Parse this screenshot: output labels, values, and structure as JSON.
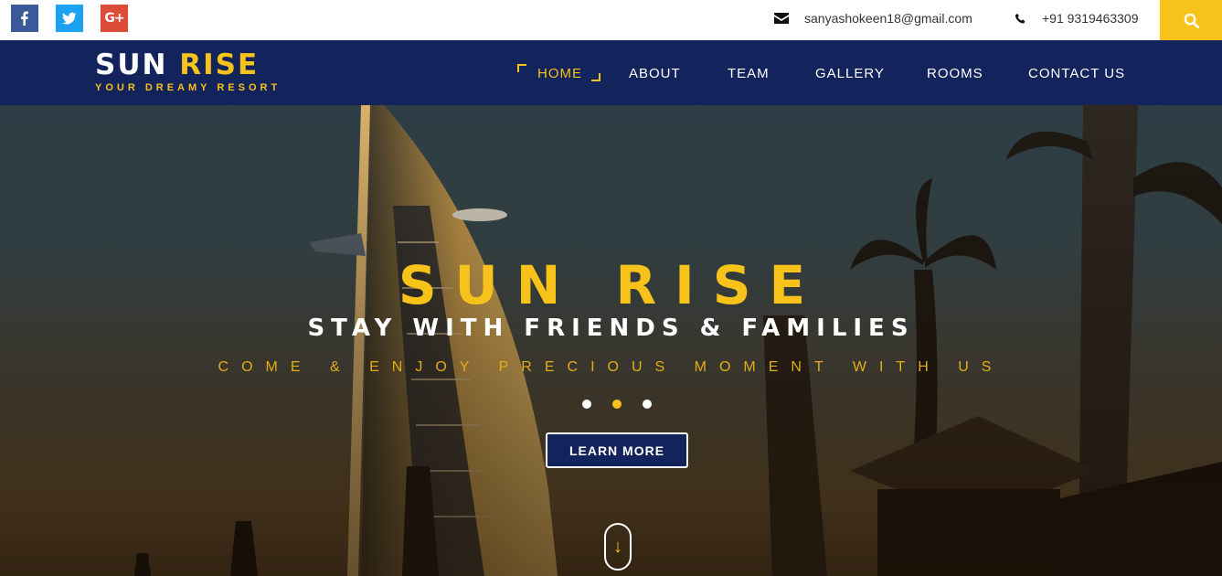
{
  "topbar": {
    "social": [
      "facebook-icon",
      "twitter-icon",
      "google-plus-icon"
    ],
    "google_plus_text": "G+",
    "email": "sanyashokeen18@gmail.com",
    "phone": "+91 9319463309"
  },
  "brand": {
    "name_part1": "SUN",
    "name_part2": "RISE",
    "tagline": "YOUR DREAMY RESORT"
  },
  "nav": {
    "items": [
      {
        "label": "HOME",
        "active": true
      },
      {
        "label": "ABOUT"
      },
      {
        "label": "TEAM"
      },
      {
        "label": "GALLERY"
      },
      {
        "label": "ROOMS"
      },
      {
        "label": "CONTACT US"
      }
    ]
  },
  "hero": {
    "title": "SUN RISE",
    "subtitle": "STAY WITH FRIENDS & FAMILIES",
    "tagline": "COME & ENJOY PRECIOUS MOMENT WITH US",
    "slides": 3,
    "active_slide": 2,
    "button": "LEARN MORE",
    "scroll_icon": "arrow-down-icon"
  },
  "colors": {
    "accent": "#f7c31b",
    "navy": "#13235b"
  }
}
